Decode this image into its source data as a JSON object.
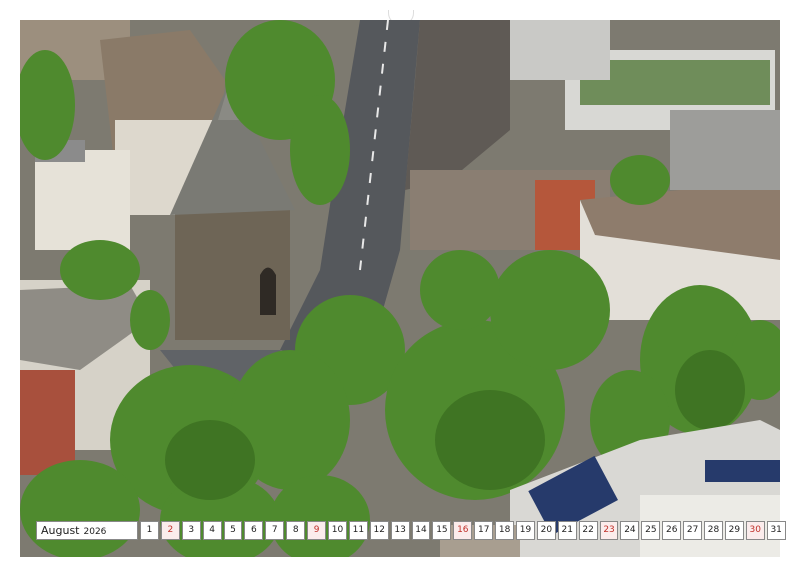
{
  "calendar": {
    "month": "August",
    "year": "2026",
    "days": [
      {
        "d": "1",
        "sun": false
      },
      {
        "d": "2",
        "sun": true
      },
      {
        "d": "3",
        "sun": false
      },
      {
        "d": "4",
        "sun": false
      },
      {
        "d": "5",
        "sun": false
      },
      {
        "d": "6",
        "sun": false
      },
      {
        "d": "7",
        "sun": false
      },
      {
        "d": "8",
        "sun": false
      },
      {
        "d": "9",
        "sun": true
      },
      {
        "d": "10",
        "sun": false
      },
      {
        "d": "11",
        "sun": false
      },
      {
        "d": "12",
        "sun": false
      },
      {
        "d": "13",
        "sun": false
      },
      {
        "d": "14",
        "sun": false
      },
      {
        "d": "15",
        "sun": false
      },
      {
        "d": "16",
        "sun": true
      },
      {
        "d": "17",
        "sun": false
      },
      {
        "d": "18",
        "sun": false
      },
      {
        "d": "19",
        "sun": false
      },
      {
        "d": "20",
        "sun": false
      },
      {
        "d": "21",
        "sun": false
      },
      {
        "d": "22",
        "sun": false
      },
      {
        "d": "23",
        "sun": true
      },
      {
        "d": "24",
        "sun": false
      },
      {
        "d": "25",
        "sun": false
      },
      {
        "d": "26",
        "sun": false
      },
      {
        "d": "27",
        "sun": false
      },
      {
        "d": "28",
        "sun": false
      },
      {
        "d": "29",
        "sun": false
      },
      {
        "d": "30",
        "sun": true
      },
      {
        "d": "31",
        "sun": false
      }
    ]
  },
  "colors": {
    "sunday": "#c0302a",
    "tree": "#4f8a2e",
    "road": "#5b5e62"
  }
}
